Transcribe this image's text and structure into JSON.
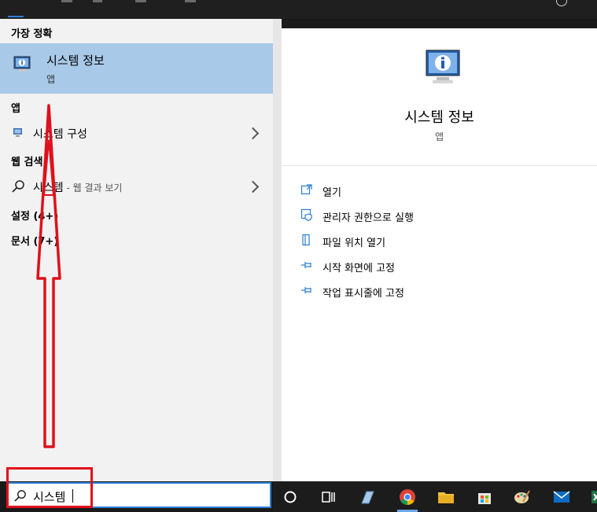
{
  "search": {
    "query": "시스템"
  },
  "left": {
    "best_match_header": "가장 정확",
    "best_match": {
      "title": "시스템 정보",
      "subtitle": "앱"
    },
    "apps_header": "앱",
    "app_item": {
      "label": "시스템 구성"
    },
    "web_header": "웹 검색",
    "web_item": {
      "query": "시스템",
      "suffix": " - 웹 결과 보기"
    },
    "settings_header": "설정 (4+)",
    "documents_header": "문서 (7+)"
  },
  "right": {
    "title": "시스템 정보",
    "subtitle": "앱",
    "actions": [
      {
        "label": "열기",
        "icon": "open-icon"
      },
      {
        "label": "관리자 권한으로 실행",
        "icon": "shield-icon"
      },
      {
        "label": "파일 위치 열기",
        "icon": "file-location-icon"
      },
      {
        "label": "시작 화면에 고정",
        "icon": "pin-icon"
      },
      {
        "label": "작업 표시줄에 고정",
        "icon": "pin-icon"
      }
    ]
  },
  "taskbar": {
    "items": [
      "cortana-icon",
      "task-view-icon",
      "app-icon",
      "chrome-icon",
      "file-explorer-icon",
      "store-icon",
      "paint-icon",
      "mail-icon",
      "excel-icon"
    ]
  },
  "colors": {
    "accent": "#2a7fd4",
    "selection": "#a9c9e8",
    "annotation": "#e0101a"
  }
}
